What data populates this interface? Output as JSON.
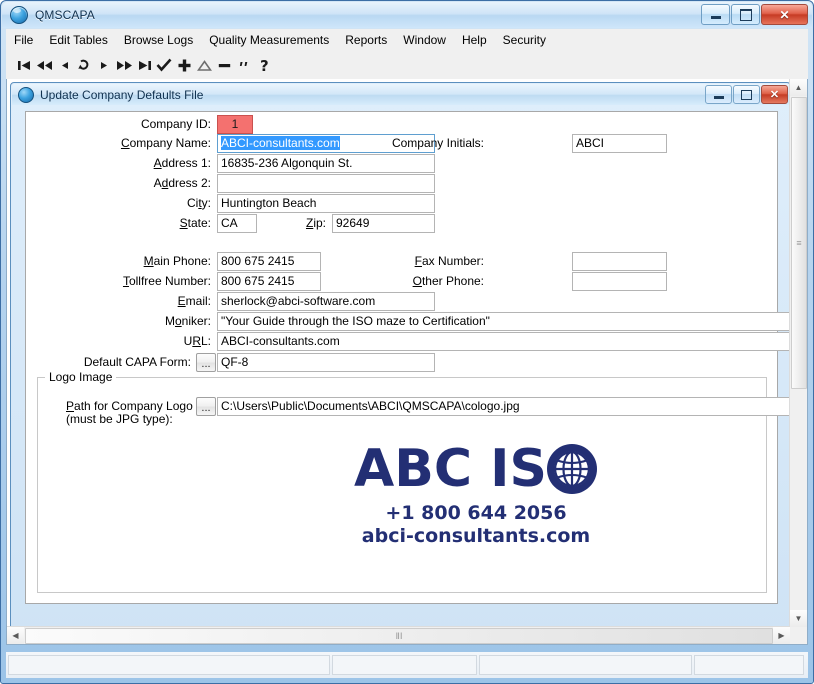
{
  "window": {
    "title": "QMSCAPA",
    "app_icon": "globe-icon",
    "minimize_label": "Minimize",
    "maximize_label": "Maximize",
    "close_label": "✕"
  },
  "menu": {
    "items": [
      {
        "label": "File"
      },
      {
        "label": "Edit Tables"
      },
      {
        "label": "Browse Logs"
      },
      {
        "label": "Quality Measurements"
      },
      {
        "label": "Reports"
      },
      {
        "label": "Window"
      },
      {
        "label": "Help"
      },
      {
        "label": "Security"
      }
    ]
  },
  "toolbar": {
    "buttons": [
      {
        "name": "first-record-icon",
        "glyph": "⏮"
      },
      {
        "name": "fast-rewind-icon",
        "glyph": "⏪"
      },
      {
        "name": "previous-record-icon",
        "glyph": "◀"
      },
      {
        "name": "refresh-icon",
        "glyph": "↺"
      },
      {
        "name": "next-record-icon",
        "glyph": "▶"
      },
      {
        "name": "fast-forward-icon",
        "glyph": "⏩"
      },
      {
        "name": "last-record-icon",
        "glyph": "⏭"
      },
      {
        "name": "accept-check-icon",
        "glyph": "✔"
      },
      {
        "name": "add-record-icon",
        "glyph": "✚"
      },
      {
        "name": "edit-triangle-icon",
        "glyph": "△"
      },
      {
        "name": "delete-record-icon",
        "glyph": "➖"
      },
      {
        "name": "cancel-quote-icon",
        "glyph": "”"
      },
      {
        "name": "help-question-icon",
        "glyph": "?"
      }
    ]
  },
  "child_window": {
    "title": "Update Company Defaults File",
    "icon": "globe-icon",
    "minimize_label": "Minimize",
    "restore_label": "Restore",
    "close_label": "✕"
  },
  "form": {
    "fields": {
      "company_id": {
        "label": "Company ID:",
        "value": "1"
      },
      "company_name": {
        "label": "Company Name:",
        "accesskey": "C",
        "value": "ABCI-consultants.com",
        "selected": true
      },
      "address1": {
        "label": "Address 1:",
        "accesskey": "A",
        "value": "16835-236 Algonquin St."
      },
      "address2": {
        "label": "Address 2:",
        "accesskey": "d",
        "value": ""
      },
      "city": {
        "label": "City:",
        "accesskey": "t",
        "value": "Huntington Beach"
      },
      "state": {
        "label": "State:",
        "accesskey": "S",
        "value": "CA"
      },
      "zip": {
        "label": "Zip:",
        "accesskey": "Z",
        "value": "92649"
      },
      "company_initials": {
        "label": "Company Initials:",
        "value": "ABCI"
      },
      "main_phone": {
        "label": "Main Phone:",
        "accesskey": "M",
        "value": "800 675 2415"
      },
      "tollfree_number": {
        "label": "Tollfree Number:",
        "accesskey": "T",
        "value": "800 675 2415"
      },
      "fax_number": {
        "label": "Fax Number:",
        "accesskey": "F",
        "value": ""
      },
      "other_phone": {
        "label": "Other Phone:",
        "accesskey": "O",
        "value": ""
      },
      "email": {
        "label": "Email:",
        "accesskey": "E",
        "value": "sherlock@abci-software.com"
      },
      "moniker": {
        "label": "Moniker:",
        "accesskey": "o",
        "value": "\"Your Guide through the ISO maze to Certification\""
      },
      "url": {
        "label": "URL:",
        "accesskey": "R",
        "value": "ABCI-consultants.com"
      },
      "default_capa_form": {
        "label": "Default CAPA Form:",
        "value": "QF-8",
        "browse_label": "..."
      }
    },
    "logo_group": {
      "legend": "Logo Image",
      "path_label_line1": "Path for Company Logo",
      "path_label_line2": "(must be JPG type):",
      "path_accesskey": "P",
      "browse_label": "...",
      "path_value": "C:\\Users\\Public\\Documents\\ABCI\\QMSCAPA\\cologo.jpg"
    },
    "logo_image": {
      "wordmark": "ABC ISO",
      "wordmark_text": "ABC IS",
      "globe_icon": "globe-logo-icon",
      "phone": "+1 800 644 2056",
      "website": "abci-consultants.com",
      "color": "#232f74"
    }
  },
  "scrollbars": {
    "vertical": {
      "up_arrow": "▲",
      "down_arrow": "▼",
      "grip": "≡"
    },
    "horizontal": {
      "left_arrow": "◀",
      "right_arrow": "▶",
      "grip": "ⅡⅠ"
    }
  },
  "statusbar": {
    "panels": [
      {
        "text": ""
      },
      {
        "text": ""
      },
      {
        "text": ""
      },
      {
        "text": ""
      }
    ]
  },
  "colors": {
    "accent": "#3c6ea5",
    "id_field": "#f4716f",
    "selection": "#3399ff",
    "logo": "#232f74"
  }
}
